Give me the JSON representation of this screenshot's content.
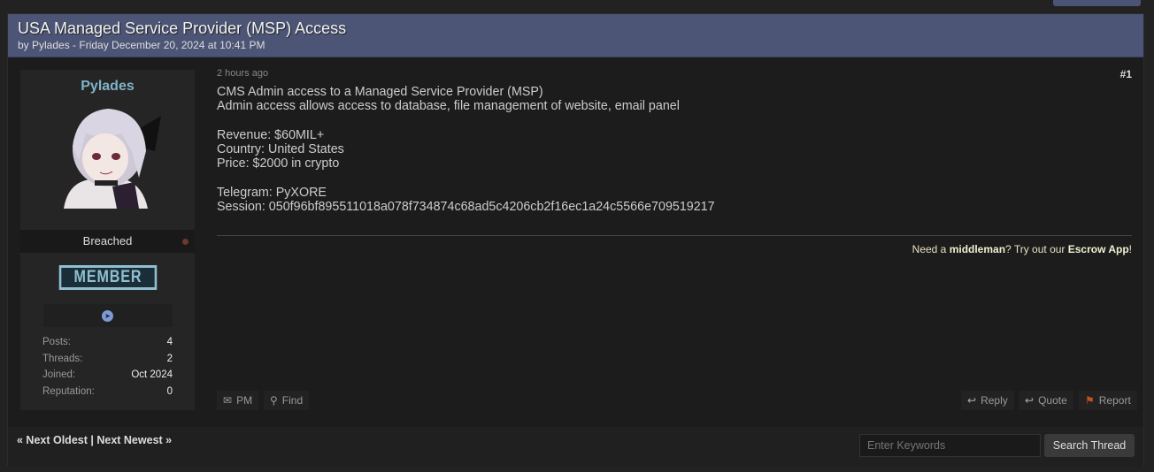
{
  "thread": {
    "title": "USA Managed Service Provider (MSP) Access",
    "byline": "by Pylades - Friday December 20, 2024 at 10:41 PM"
  },
  "user": {
    "name": "Pylades",
    "rank": "Breached",
    "badge": "MEMBER",
    "contact_icon": "telegram-icon",
    "stats": [
      {
        "k": "Posts:",
        "v": "4"
      },
      {
        "k": "Threads:",
        "v": "2"
      },
      {
        "k": "Joined:",
        "v": "Oct 2024"
      },
      {
        "k": "Reputation:",
        "v": "0"
      }
    ]
  },
  "post": {
    "time": "2 hours ago",
    "number": "#1",
    "lines": [
      "CMS Admin access to a Managed Service Provider (MSP)",
      "Admin access allows access to database, file management of website, email panel",
      "",
      "Revenue: $60MIL+",
      "Country: United States",
      "Price: $2000 in crypto",
      "",
      "Telegram: PyXORE",
      "Session: 050f96bf895511018a078f734874c68ad5c4206cb2f16ec1a24c5566e709519217"
    ],
    "sig": {
      "a": "Need a ",
      "b": "middleman",
      "c": "? Try out our ",
      "d": "Escrow App",
      "e": "!"
    }
  },
  "buttons": {
    "pm": "PM",
    "find": "Find",
    "reply": "Reply",
    "quote": "Quote",
    "report": "Report"
  },
  "footer": {
    "next_oldest": "« Next Oldest",
    "sep": " | ",
    "next_newest": "Next Newest »",
    "keywords_placeholder": "Enter Keywords",
    "search": "Search Thread"
  },
  "colors": {
    "header": "#4c5576",
    "username": "#7fb3c8",
    "report_flag": "#c0521f"
  }
}
